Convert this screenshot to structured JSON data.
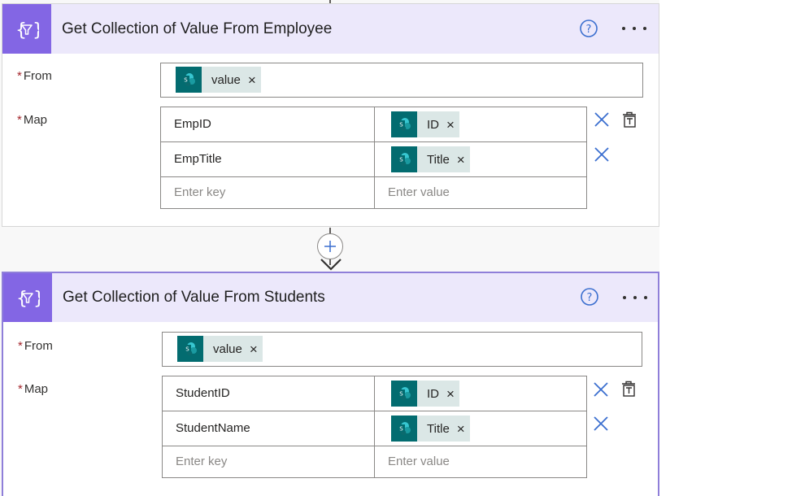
{
  "actions": [
    {
      "title": "Get Collection of Value From Employee",
      "from_label": "From",
      "map_label": "Map",
      "required_marker": "*",
      "from_token": {
        "label": "value",
        "remove": "×"
      },
      "map_rows": [
        {
          "key": "EmpID",
          "value_token": "ID",
          "remove": "×"
        },
        {
          "key": "EmpTitle",
          "value_token": "Title",
          "remove": "×"
        }
      ],
      "key_placeholder": "Enter key",
      "value_placeholder": "Enter value"
    },
    {
      "title": "Get Collection of Value From Students",
      "from_label": "From",
      "map_label": "Map",
      "required_marker": "*",
      "from_token": {
        "label": "value",
        "remove": "×"
      },
      "map_rows": [
        {
          "key": "StudentID",
          "value_token": "ID",
          "remove": "×"
        },
        {
          "key": "StudentName",
          "value_token": "Title",
          "remove": "×"
        }
      ],
      "key_placeholder": "Enter key",
      "value_placeholder": "Enter value"
    }
  ],
  "icons": {
    "action": "data-operation-select-icon",
    "help": "help-circle-icon",
    "more": "more-options-icon",
    "token": "sharepoint-icon",
    "row_remove": "close-icon",
    "switch_mode": "switch-to-text-mode-icon",
    "connector": "add-step-icon"
  },
  "colors": {
    "action_accent": "#8366e4",
    "header_background": "#ece8fb",
    "token_background": "#dbe7e6",
    "sharepoint_icon": "#036c70",
    "link_blue": "#3b6fcf",
    "required": "#a4262c",
    "selected_border": "#8f7fd9"
  }
}
